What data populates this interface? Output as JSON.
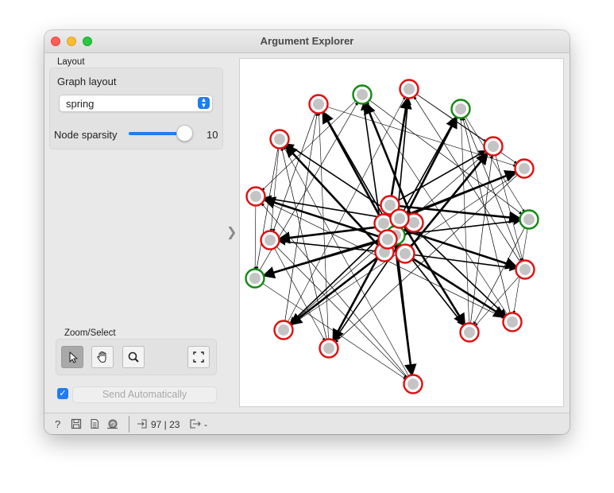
{
  "window": {
    "title": "Argument Explorer"
  },
  "layout_section": {
    "label": "Layout",
    "graph_layout_label": "Graph layout",
    "graph_layout_value": "spring",
    "node_sparsity_label": "Node sparsity",
    "node_sparsity_value": "10",
    "node_sparsity_fraction": 0.92
  },
  "zoom_section": {
    "label": "Zoom/Select",
    "tools": [
      "pointer-tool",
      "pan-tool",
      "zoom-tool",
      "fit-view-tool"
    ],
    "active_tool": "pointer-tool"
  },
  "send": {
    "checked": true,
    "label": "Send Automatically"
  },
  "status": {
    "input_summary": "97 | 23",
    "output_summary": "-"
  },
  "colors": {
    "accent": "#1f7cf0",
    "node_attacking": "#e11010",
    "node_supporting": "#138a13",
    "node_fill": "#c4c4c4"
  }
}
